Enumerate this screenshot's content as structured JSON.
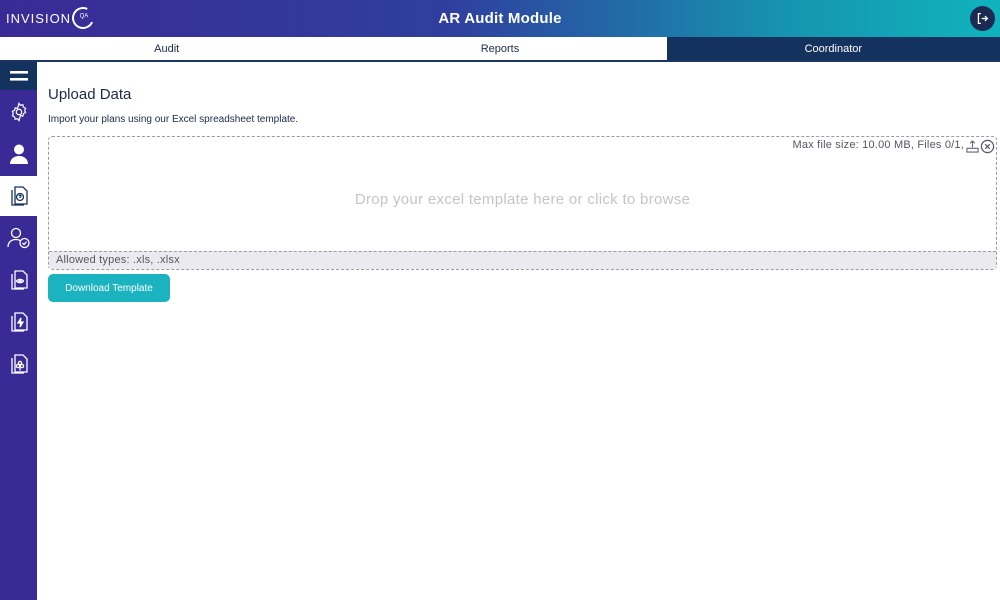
{
  "header": {
    "logo_text": "INVISION",
    "logo_sub": "QA",
    "title": "AR Audit Module",
    "logout_icon": "logout-icon"
  },
  "tabs": [
    {
      "label": "Audit",
      "active": false
    },
    {
      "label": "Reports",
      "active": false
    },
    {
      "label": "Coordinator",
      "active": true
    }
  ],
  "sidebar": {
    "items": [
      {
        "icon": "menu-icon"
      },
      {
        "icon": "settings-icon"
      },
      {
        "icon": "user-icon"
      },
      {
        "icon": "document-question-icon",
        "active": true
      },
      {
        "icon": "user-check-icon"
      },
      {
        "icon": "document-eye-icon"
      },
      {
        "icon": "document-bolt-icon"
      },
      {
        "icon": "document-flower-icon"
      }
    ]
  },
  "main": {
    "title": "Upload Data",
    "subtitle": "Import your plans using our Excel spreadsheet template.",
    "dropzone": {
      "meta": "Max file size: 10.00 MB, Files 0/1,",
      "prompt": "Drop your excel template here or click to browse",
      "allowed": "Allowed types: .xls, .xlsx"
    },
    "download_button": "Download Template"
  },
  "colors": {
    "brand_purple": "#3a2a96",
    "navy": "#14325e",
    "teal": "#1cb3c1"
  }
}
